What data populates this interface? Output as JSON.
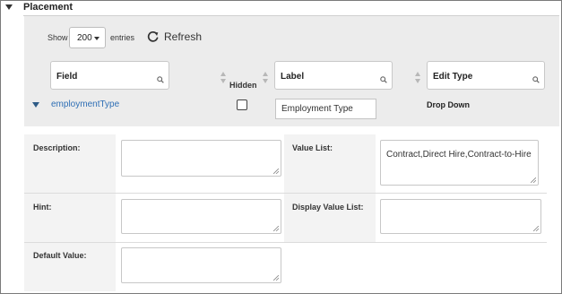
{
  "section": {
    "title": "Placement"
  },
  "toolbar": {
    "show_label": "Show",
    "entries_value": "200",
    "entries_suffix": "entries",
    "refresh_label": "Refresh"
  },
  "columns": {
    "field": "Field",
    "hidden": "Hidden",
    "label": "Label",
    "edit_type": "Edit Type"
  },
  "row": {
    "field_name": "employmentType",
    "hidden_checked": false,
    "label_value": "Employment Type",
    "edit_type": "Drop Down"
  },
  "details": {
    "description_label": "Description:",
    "description_value": "",
    "value_list_label": "Value List:",
    "value_list_value": "Contract,Direct Hire,Contract-to-Hire",
    "hint_label": "Hint:",
    "hint_value": "",
    "display_value_list_label": "Display Value List:",
    "display_value_list_value": "",
    "default_value_label": "Default Value:",
    "default_value_value": ""
  },
  "colors": {
    "link": "#2f6fb5",
    "panel_gray": "#ececec",
    "border": "#c8c8c8"
  }
}
